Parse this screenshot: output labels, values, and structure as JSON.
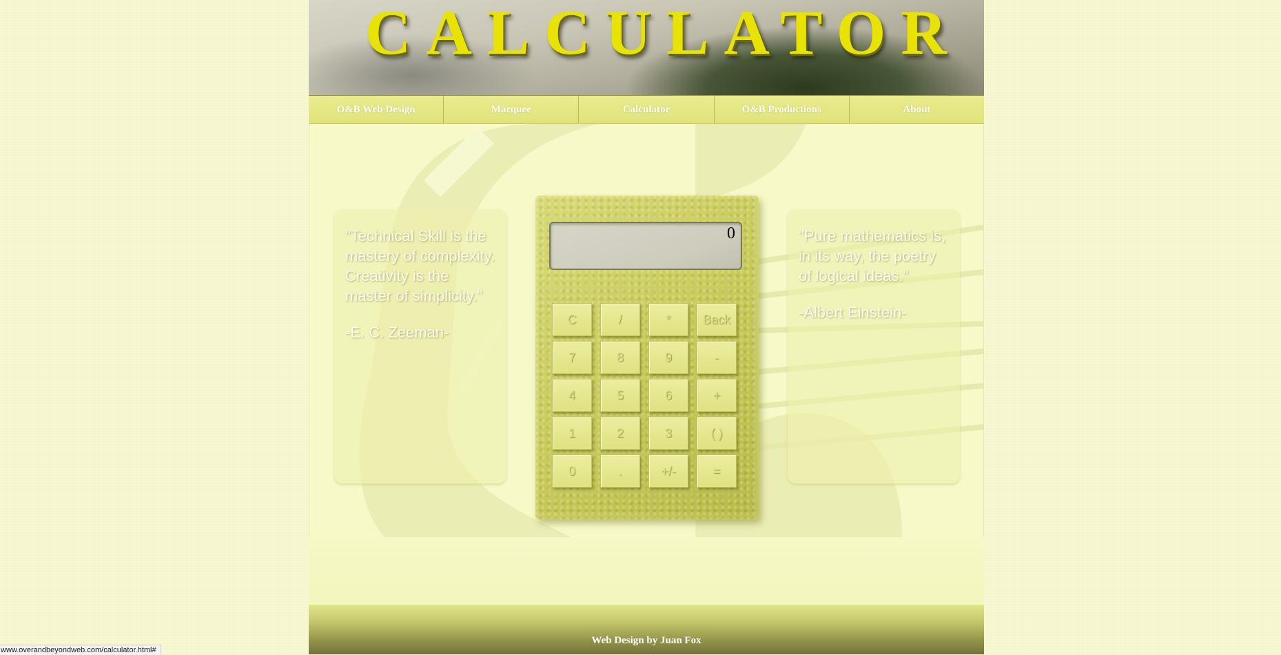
{
  "banner": {
    "title": "CALCULATOR"
  },
  "nav": {
    "items": [
      {
        "label": "O&B Web Design"
      },
      {
        "label": "Marquee"
      },
      {
        "label": "Calculator"
      },
      {
        "label": "O&B Productions"
      },
      {
        "label": "About"
      }
    ]
  },
  "quotes": {
    "left": {
      "text": "\"Technical Skill is the mastery of complexity. Creativity is the master of simplicity.\"",
      "author": "-E. C. Zeeman-"
    },
    "right": {
      "text": "\"Pure mathematics is, in its way, the poetry of logical ideas.\"",
      "author": "-Albert Einstein-"
    }
  },
  "calculator": {
    "display": "0",
    "keys": [
      {
        "label": "C"
      },
      {
        "label": "/"
      },
      {
        "label": "*"
      },
      {
        "label": "Back"
      },
      {
        "label": "7"
      },
      {
        "label": "8"
      },
      {
        "label": "9"
      },
      {
        "label": "-"
      },
      {
        "label": "4"
      },
      {
        "label": "5"
      },
      {
        "label": "6"
      },
      {
        "label": "+"
      },
      {
        "label": "1"
      },
      {
        "label": "2"
      },
      {
        "label": "3"
      },
      {
        "label": "( )"
      },
      {
        "label": "0"
      },
      {
        "label": "."
      },
      {
        "label": "+/-"
      },
      {
        "label": "="
      }
    ]
  },
  "footer": {
    "credit": "Web Design by Juan Fox"
  },
  "status_bar": {
    "url": "www.overandbeyondweb.com/calculator.html#"
  },
  "colors": {
    "page_background": "#f7f8d2",
    "nav_background": "#e4e67f",
    "calculator_body": "#c9cb5a",
    "display_background": "#cdccbd",
    "title_gold": "#e8e400"
  }
}
